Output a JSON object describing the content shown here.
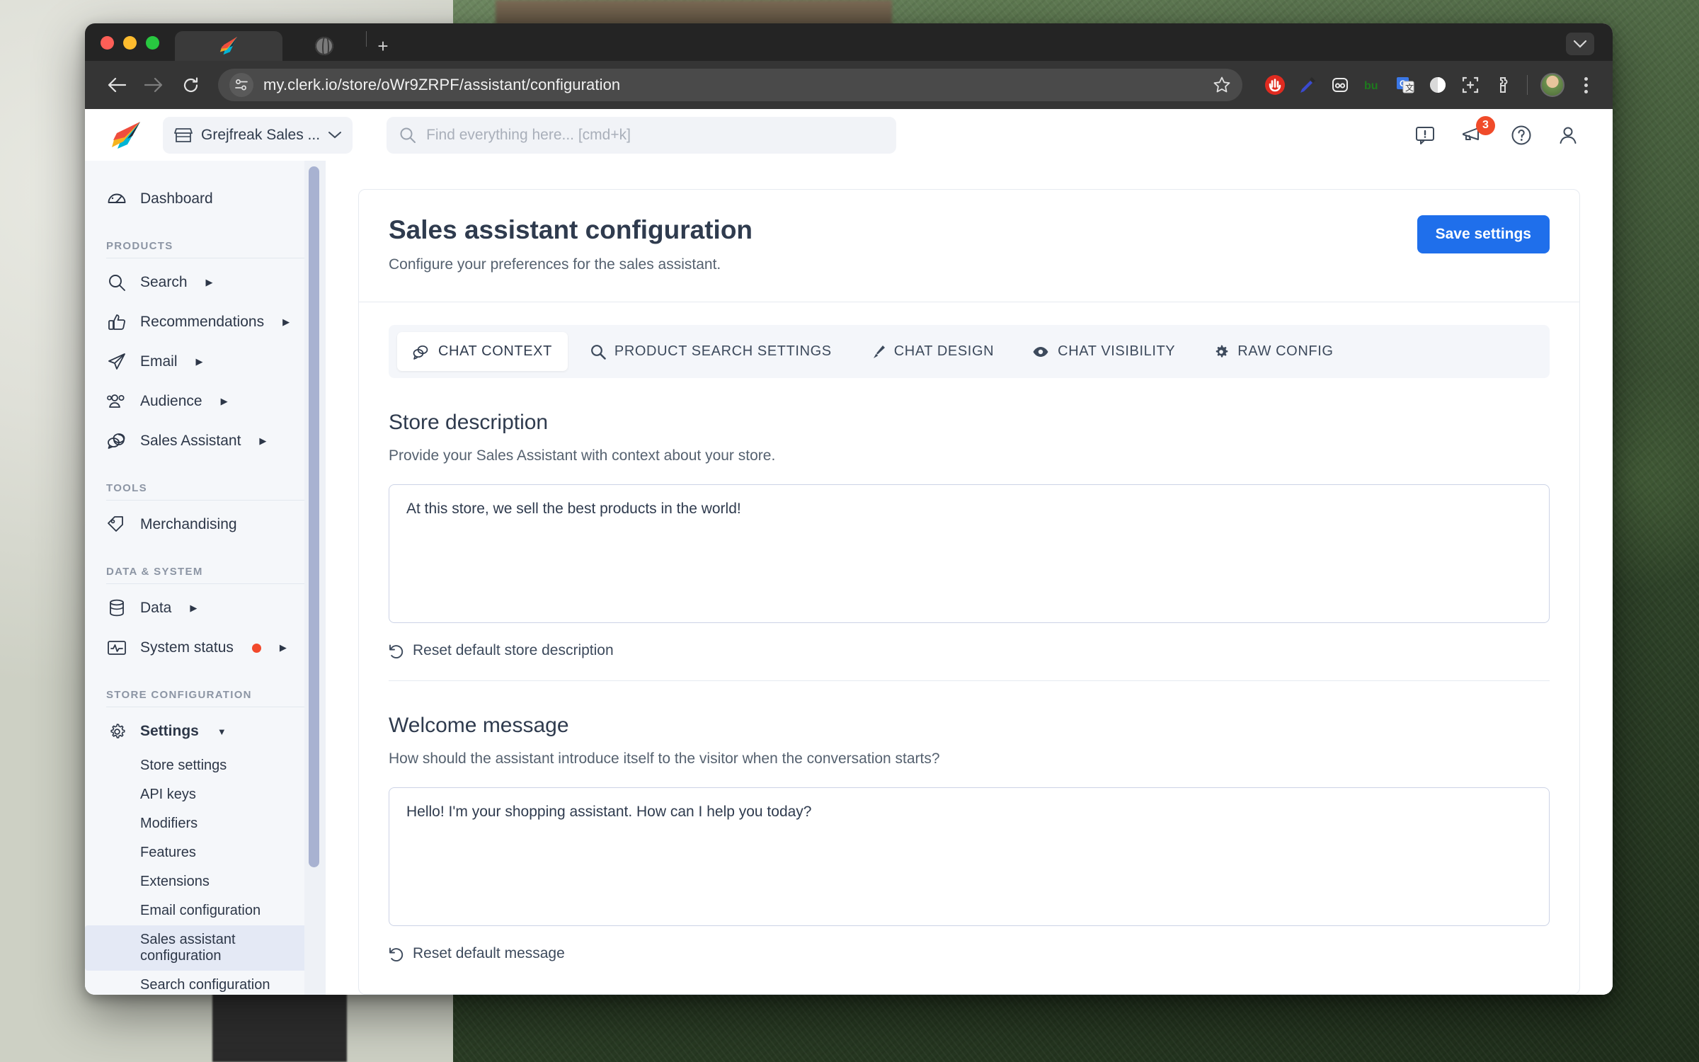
{
  "browser": {
    "tabs": [
      {
        "title_icon": "clerk-rocket-icon",
        "active": true
      },
      {
        "title_icon": "globe-icon",
        "active": false
      }
    ],
    "new_tab_label": "+",
    "url": "my.clerk.io/store/oWr9ZRPF/assistant/configuration",
    "nav": {
      "back": "back-arrow",
      "forward": "forward-arrow",
      "reload": "reload-arrow"
    },
    "extensions": [
      "adblock-hand-icon",
      "eyedropper-icon",
      "panda-icon",
      "bu-text-icon",
      "google-translate-icon",
      "circle-half-icon",
      "screenshot-crop-icon",
      "puzzle-extension-icon"
    ]
  },
  "app_header": {
    "logo": "clerk-logo",
    "store_selector": {
      "icon": "store-icon",
      "label": "Grejfreak Sales ...",
      "chevron": "chevron-down-icon"
    },
    "search": {
      "icon": "search-icon",
      "placeholder": "Find everything here... [cmd+k]"
    },
    "actions": [
      {
        "name": "feedback-icon"
      },
      {
        "name": "announcements-icon",
        "badge": "3"
      },
      {
        "name": "help-icon"
      },
      {
        "name": "account-icon"
      }
    ]
  },
  "sidebar": {
    "dashboard": {
      "icon": "speedometer-icon",
      "label": "Dashboard"
    },
    "sections": [
      {
        "label": "PRODUCTS",
        "items": [
          {
            "icon": "search-icon",
            "label": "Search",
            "expandable": true
          },
          {
            "icon": "thumbs-up-icon",
            "label": "Recommendations",
            "expandable": true
          },
          {
            "icon": "paper-plane-icon",
            "label": "Email",
            "expandable": true
          },
          {
            "icon": "people-icon",
            "label": "Audience",
            "expandable": true
          },
          {
            "icon": "chat-bubbles-icon",
            "label": "Sales Assistant",
            "expandable": true
          }
        ]
      },
      {
        "label": "TOOLS",
        "items": [
          {
            "icon": "tag-icon",
            "label": "Merchandising",
            "expandable": false
          }
        ]
      },
      {
        "label": "DATA & SYSTEM",
        "items": [
          {
            "icon": "database-icon",
            "label": "Data",
            "expandable": true
          },
          {
            "icon": "pulse-monitor-icon",
            "label": "System status",
            "expandable": true,
            "status_dot": true
          }
        ]
      },
      {
        "label": "STORE CONFIGURATION",
        "items": [
          {
            "icon": "gear-icon",
            "label": "Settings",
            "expanded": true
          }
        ],
        "subitems": [
          {
            "label": "Store settings",
            "active": false
          },
          {
            "label": "API keys",
            "active": false
          },
          {
            "label": "Modifiers",
            "active": false
          },
          {
            "label": "Features",
            "active": false
          },
          {
            "label": "Extensions",
            "active": false
          },
          {
            "label": "Email configuration",
            "active": false
          },
          {
            "label": "Sales assistant configuration",
            "active": true
          },
          {
            "label": "Search configuration",
            "active": false
          }
        ]
      }
    ]
  },
  "main": {
    "title": "Sales assistant configuration",
    "subtitle": "Configure your preferences for the sales assistant.",
    "save_label": "Save settings",
    "tabs": [
      {
        "icon": "chat-bubbles-icon",
        "label": "CHAT CONTEXT",
        "active": true
      },
      {
        "icon": "search-icon",
        "label": "PRODUCT SEARCH SETTINGS",
        "active": false
      },
      {
        "icon": "brush-icon",
        "label": "CHAT DESIGN",
        "active": false
      },
      {
        "icon": "eye-icon",
        "label": "CHAT VISIBILITY",
        "active": false
      },
      {
        "icon": "gear-icon",
        "label": "RAW CONFIG",
        "active": false
      }
    ],
    "store_description": {
      "title": "Store description",
      "description": "Provide your Sales Assistant with context about your store.",
      "value": "At this store, we sell the best products in the world!",
      "reset_label": "Reset default store description",
      "reset_icon": "undo-icon"
    },
    "welcome_message": {
      "title": "Welcome message",
      "description": "How should the assistant introduce itself to the visitor when the conversation starts?",
      "value": "Hello! I'm your shopping assistant. How can I help you today?",
      "reset_label": "Reset default message",
      "reset_icon": "undo-icon"
    }
  },
  "colors": {
    "primary": "#1f6feb",
    "badge": "#f04b2a",
    "status": "#f2492b",
    "sidebar_bg": "#f5f7fa"
  }
}
